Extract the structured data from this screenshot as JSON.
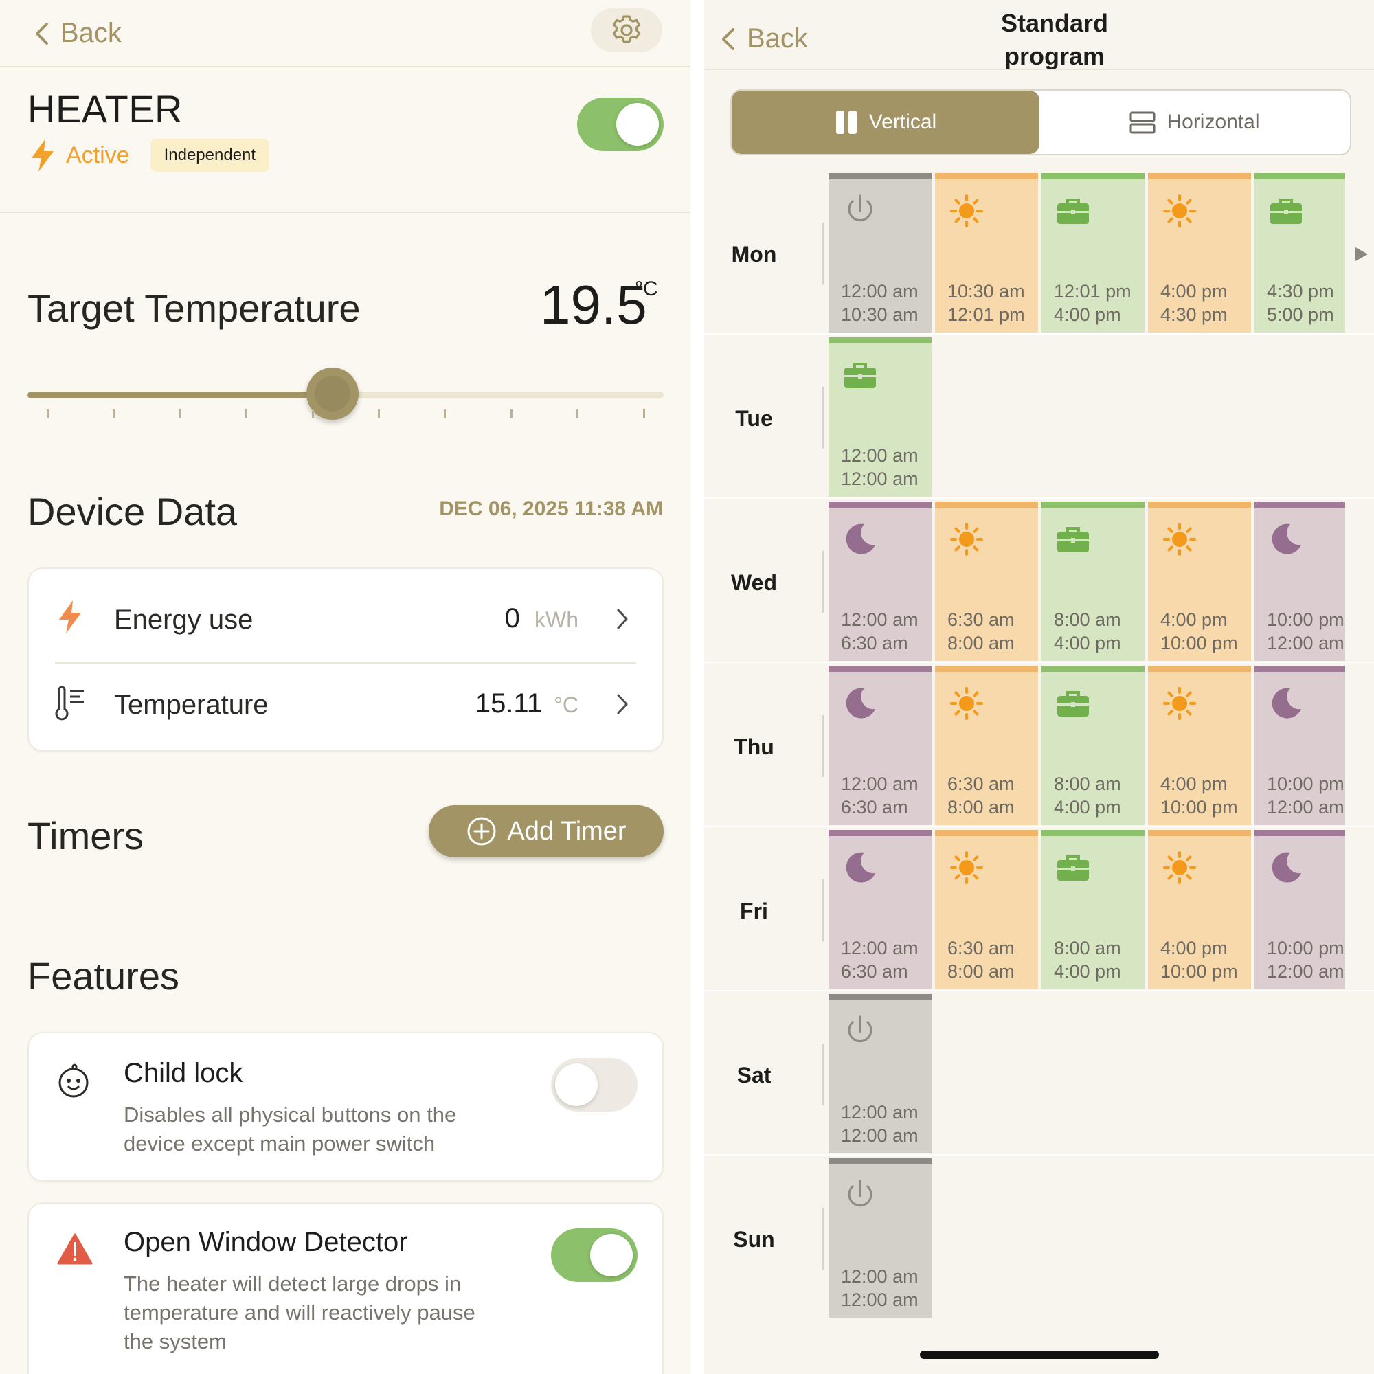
{
  "left": {
    "back_label": "Back",
    "device": {
      "name": "HEATER",
      "status": "Active",
      "mode_badge": "Independent",
      "power_on": true
    },
    "target": {
      "label": "Target Temperature",
      "value": "19.5",
      "unit": "°C",
      "slider_fraction": 0.48
    },
    "device_data": {
      "title": "Device Data",
      "timestamp": "DEC 06, 2025 11:38 AM",
      "rows": [
        {
          "label": "Energy use",
          "value": "0",
          "unit": "kWh"
        },
        {
          "label": "Temperature",
          "value": "15.11",
          "unit": "°C"
        }
      ]
    },
    "timers": {
      "title": "Timers",
      "add_label": "Add Timer"
    },
    "features": {
      "title": "Features",
      "items": [
        {
          "title": "Child lock",
          "desc1": "Disables all physical buttons on the",
          "desc2": "device except main power switch",
          "desc3": "",
          "enabled": false
        },
        {
          "title": "Open Window Detector",
          "desc1": "The heater will detect large drops in",
          "desc2": "temperature and will reactively pause",
          "desc3": "the system",
          "enabled": true
        }
      ]
    }
  },
  "right": {
    "back_label": "Back",
    "title_line1": "Standard",
    "title_line2": "program",
    "view_toggle": {
      "vertical": "Vertical",
      "horizontal": "Horizontal",
      "selected": "Vertical"
    },
    "days": [
      {
        "name": "Mon",
        "slots": [
          {
            "icon": "power-icon",
            "start": "12:00 am",
            "end": "10:30 am"
          },
          {
            "icon": "sun-icon",
            "start": "10:30 am",
            "end": "12:01 pm"
          },
          {
            "icon": "briefcase-icon",
            "start": "12:01 pm",
            "end": "4:00 pm"
          },
          {
            "icon": "sun-icon",
            "start": "4:00 pm",
            "end": "4:30 pm"
          },
          {
            "icon": "briefcase-icon",
            "start": "4:30 pm",
            "end": "5:00 pm"
          }
        ]
      },
      {
        "name": "Tue",
        "slots": [
          {
            "icon": "briefcase-icon",
            "start": "12:00 am",
            "end": "12:00 am"
          }
        ]
      },
      {
        "name": "Wed",
        "slots": [
          {
            "icon": "moon-icon",
            "start": "12:00 am",
            "end": "6:30 am"
          },
          {
            "icon": "sun-icon",
            "start": "6:30 am",
            "end": "8:00 am"
          },
          {
            "icon": "briefcase-icon",
            "start": "8:00 am",
            "end": "4:00 pm"
          },
          {
            "icon": "sun-icon",
            "start": "4:00 pm",
            "end": "10:00 pm"
          },
          {
            "icon": "moon-icon",
            "start": "10:00 pm",
            "end": "12:00 am"
          }
        ]
      },
      {
        "name": "Thu",
        "slots": [
          {
            "icon": "moon-icon",
            "start": "12:00 am",
            "end": "6:30 am"
          },
          {
            "icon": "sun-icon",
            "start": "6:30 am",
            "end": "8:00 am"
          },
          {
            "icon": "briefcase-icon",
            "start": "8:00 am",
            "end": "4:00 pm"
          },
          {
            "icon": "sun-icon",
            "start": "4:00 pm",
            "end": "10:00 pm"
          },
          {
            "icon": "moon-icon",
            "start": "10:00 pm",
            "end": "12:00 am"
          }
        ]
      },
      {
        "name": "Fri",
        "slots": [
          {
            "icon": "moon-icon",
            "start": "12:00 am",
            "end": "6:30 am"
          },
          {
            "icon": "sun-icon",
            "start": "6:30 am",
            "end": "8:00 am"
          },
          {
            "icon": "briefcase-icon",
            "start": "8:00 am",
            "end": "4:00 pm"
          },
          {
            "icon": "sun-icon",
            "start": "4:00 pm",
            "end": "10:00 pm"
          },
          {
            "icon": "moon-icon",
            "start": "10:00 pm",
            "end": "12:00 am"
          }
        ]
      },
      {
        "name": "Sat",
        "slots": [
          {
            "icon": "power-icon",
            "start": "12:00 am",
            "end": "12:00 am"
          }
        ]
      },
      {
        "name": "Sun",
        "slots": [
          {
            "icon": "power-icon",
            "start": "12:00 am",
            "end": "12:00 am"
          }
        ]
      }
    ]
  },
  "colors": {
    "accent": "#a39466",
    "toggle_on": "#8cc06a",
    "active": "#f2a12a",
    "warning": "#e25b45"
  }
}
